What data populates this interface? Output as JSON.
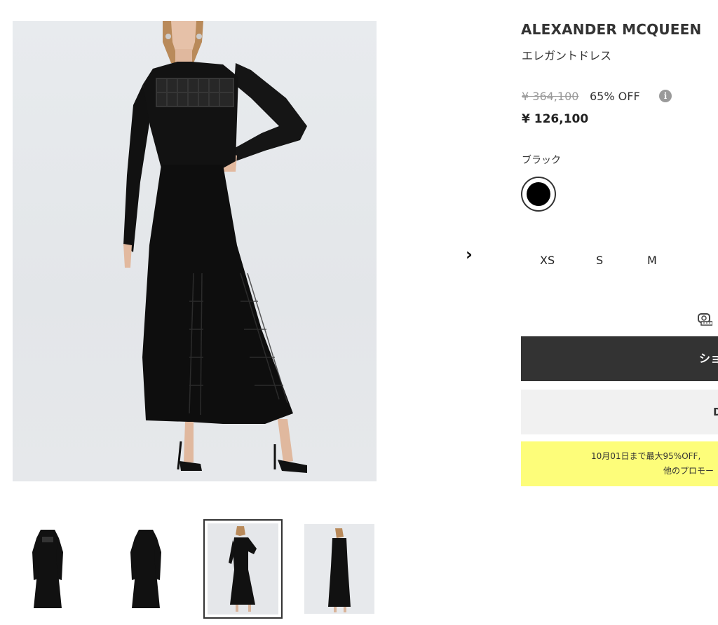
{
  "product": {
    "brand": "ALEXANDER MCQUEEN",
    "name": "エレガントドレス",
    "original_price": "¥ 364,100",
    "discount": "65% OFF",
    "price": "¥ 126,100",
    "color_label": "ブラック",
    "sizes": [
      "XS",
      "S",
      "M"
    ]
  },
  "buttons": {
    "primary_label": "ショ",
    "secondary_label": "D"
  },
  "promo": {
    "line1": "10月01日まで最大95%OFF,",
    "line2": "他のプロモー"
  },
  "gallery": {
    "thumbnail_count": 4,
    "selected_index": 2
  },
  "icons": {
    "next": "chevron-right-icon",
    "info": "info-icon",
    "measure": "measuring-tape-icon"
  },
  "colors": {
    "primary_button": "#333333",
    "secondary_button": "#f1f1f1",
    "promo_background": "#fdfd7a",
    "swatch": "#000000"
  }
}
